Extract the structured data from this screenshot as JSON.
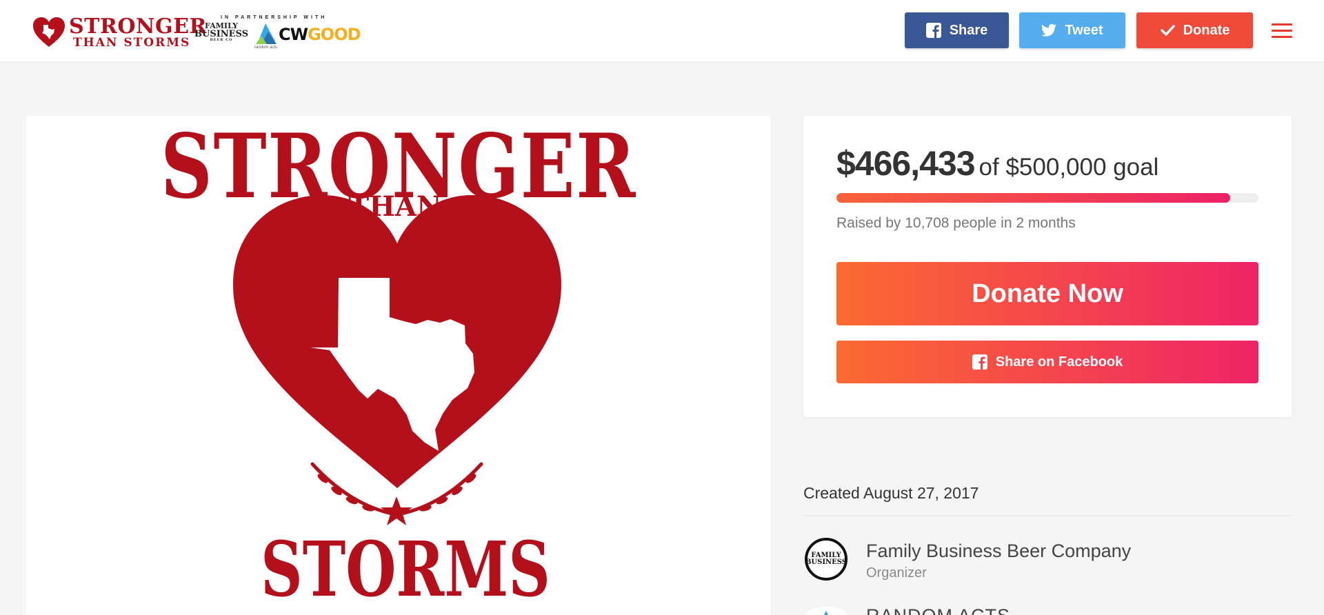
{
  "header": {
    "logo": {
      "line1": "STRONGER",
      "line2": "THAN STORMS"
    },
    "partnership_text": "IN PARTNERSHIP WITH",
    "family_business_logo": {
      "line1": "FAMILY",
      "line2": "BUSINESS",
      "line3": "BEER CO"
    },
    "random_acts_text": "random acts",
    "cwgood_logo": {
      "cw": "CW",
      "good": "GOOD"
    },
    "share_label": "Share",
    "tweet_label": "Tweet",
    "donate_label": "Donate",
    "icons": {
      "share": "facebook-icon",
      "tweet": "twitter-icon",
      "donate": "check-icon",
      "menu": "hamburger-menu-icon"
    }
  },
  "campaign_image": {
    "top_text": "STRONGER",
    "middle_text": "THAN",
    "bottom_text": "STORMS",
    "colors": {
      "red": "#b3101c",
      "white": "#ffffff"
    }
  },
  "donation": {
    "amount": "$466,433",
    "goal_text": "of $500,000 goal",
    "progress_fraction": 0.9329,
    "raised_text": "Raised by 10,708 people in 2 months",
    "donate_now_label": "Donate Now",
    "share_facebook_label": "Share on Facebook",
    "gradient": {
      "from": "#fb6a32",
      "to": "#ee2466"
    }
  },
  "details": {
    "created": "Created August 27, 2017",
    "organizer": {
      "name": "Family Business Beer Company",
      "role": "Organizer",
      "avatar_line1": "FAMILY",
      "avatar_line2": "BUSINESS"
    },
    "second_person": {
      "name": "RANDOM ACTS"
    }
  },
  "colors": {
    "facebook": "#3a5795",
    "twitter": "#55acee",
    "donate": "#f04a3a",
    "menu": "#e8392e"
  }
}
